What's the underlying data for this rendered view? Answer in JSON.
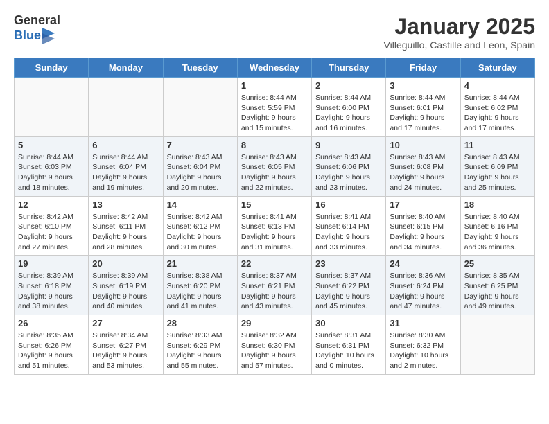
{
  "header": {
    "logo": {
      "general": "General",
      "blue": "Blue"
    },
    "title": "January 2025",
    "subtitle": "Villeguillo, Castille and Leon, Spain"
  },
  "weekdays": [
    "Sunday",
    "Monday",
    "Tuesday",
    "Wednesday",
    "Thursday",
    "Friday",
    "Saturday"
  ],
  "weeks": [
    [
      {
        "day": "",
        "sunrise": "",
        "sunset": "",
        "daylight": ""
      },
      {
        "day": "",
        "sunrise": "",
        "sunset": "",
        "daylight": ""
      },
      {
        "day": "",
        "sunrise": "",
        "sunset": "",
        "daylight": ""
      },
      {
        "day": "1",
        "sunrise": "Sunrise: 8:44 AM",
        "sunset": "Sunset: 5:59 PM",
        "daylight": "Daylight: 9 hours and 15 minutes."
      },
      {
        "day": "2",
        "sunrise": "Sunrise: 8:44 AM",
        "sunset": "Sunset: 6:00 PM",
        "daylight": "Daylight: 9 hours and 16 minutes."
      },
      {
        "day": "3",
        "sunrise": "Sunrise: 8:44 AM",
        "sunset": "Sunset: 6:01 PM",
        "daylight": "Daylight: 9 hours and 17 minutes."
      },
      {
        "day": "4",
        "sunrise": "Sunrise: 8:44 AM",
        "sunset": "Sunset: 6:02 PM",
        "daylight": "Daylight: 9 hours and 17 minutes."
      }
    ],
    [
      {
        "day": "5",
        "sunrise": "Sunrise: 8:44 AM",
        "sunset": "Sunset: 6:03 PM",
        "daylight": "Daylight: 9 hours and 18 minutes."
      },
      {
        "day": "6",
        "sunrise": "Sunrise: 8:44 AM",
        "sunset": "Sunset: 6:04 PM",
        "daylight": "Daylight: 9 hours and 19 minutes."
      },
      {
        "day": "7",
        "sunrise": "Sunrise: 8:43 AM",
        "sunset": "Sunset: 6:04 PM",
        "daylight": "Daylight: 9 hours and 20 minutes."
      },
      {
        "day": "8",
        "sunrise": "Sunrise: 8:43 AM",
        "sunset": "Sunset: 6:05 PM",
        "daylight": "Daylight: 9 hours and 22 minutes."
      },
      {
        "day": "9",
        "sunrise": "Sunrise: 8:43 AM",
        "sunset": "Sunset: 6:06 PM",
        "daylight": "Daylight: 9 hours and 23 minutes."
      },
      {
        "day": "10",
        "sunrise": "Sunrise: 8:43 AM",
        "sunset": "Sunset: 6:08 PM",
        "daylight": "Daylight: 9 hours and 24 minutes."
      },
      {
        "day": "11",
        "sunrise": "Sunrise: 8:43 AM",
        "sunset": "Sunset: 6:09 PM",
        "daylight": "Daylight: 9 hours and 25 minutes."
      }
    ],
    [
      {
        "day": "12",
        "sunrise": "Sunrise: 8:42 AM",
        "sunset": "Sunset: 6:10 PM",
        "daylight": "Daylight: 9 hours and 27 minutes."
      },
      {
        "day": "13",
        "sunrise": "Sunrise: 8:42 AM",
        "sunset": "Sunset: 6:11 PM",
        "daylight": "Daylight: 9 hours and 28 minutes."
      },
      {
        "day": "14",
        "sunrise": "Sunrise: 8:42 AM",
        "sunset": "Sunset: 6:12 PM",
        "daylight": "Daylight: 9 hours and 30 minutes."
      },
      {
        "day": "15",
        "sunrise": "Sunrise: 8:41 AM",
        "sunset": "Sunset: 6:13 PM",
        "daylight": "Daylight: 9 hours and 31 minutes."
      },
      {
        "day": "16",
        "sunrise": "Sunrise: 8:41 AM",
        "sunset": "Sunset: 6:14 PM",
        "daylight": "Daylight: 9 hours and 33 minutes."
      },
      {
        "day": "17",
        "sunrise": "Sunrise: 8:40 AM",
        "sunset": "Sunset: 6:15 PM",
        "daylight": "Daylight: 9 hours and 34 minutes."
      },
      {
        "day": "18",
        "sunrise": "Sunrise: 8:40 AM",
        "sunset": "Sunset: 6:16 PM",
        "daylight": "Daylight: 9 hours and 36 minutes."
      }
    ],
    [
      {
        "day": "19",
        "sunrise": "Sunrise: 8:39 AM",
        "sunset": "Sunset: 6:18 PM",
        "daylight": "Daylight: 9 hours and 38 minutes."
      },
      {
        "day": "20",
        "sunrise": "Sunrise: 8:39 AM",
        "sunset": "Sunset: 6:19 PM",
        "daylight": "Daylight: 9 hours and 40 minutes."
      },
      {
        "day": "21",
        "sunrise": "Sunrise: 8:38 AM",
        "sunset": "Sunset: 6:20 PM",
        "daylight": "Daylight: 9 hours and 41 minutes."
      },
      {
        "day": "22",
        "sunrise": "Sunrise: 8:37 AM",
        "sunset": "Sunset: 6:21 PM",
        "daylight": "Daylight: 9 hours and 43 minutes."
      },
      {
        "day": "23",
        "sunrise": "Sunrise: 8:37 AM",
        "sunset": "Sunset: 6:22 PM",
        "daylight": "Daylight: 9 hours and 45 minutes."
      },
      {
        "day": "24",
        "sunrise": "Sunrise: 8:36 AM",
        "sunset": "Sunset: 6:24 PM",
        "daylight": "Daylight: 9 hours and 47 minutes."
      },
      {
        "day": "25",
        "sunrise": "Sunrise: 8:35 AM",
        "sunset": "Sunset: 6:25 PM",
        "daylight": "Daylight: 9 hours and 49 minutes."
      }
    ],
    [
      {
        "day": "26",
        "sunrise": "Sunrise: 8:35 AM",
        "sunset": "Sunset: 6:26 PM",
        "daylight": "Daylight: 9 hours and 51 minutes."
      },
      {
        "day": "27",
        "sunrise": "Sunrise: 8:34 AM",
        "sunset": "Sunset: 6:27 PM",
        "daylight": "Daylight: 9 hours and 53 minutes."
      },
      {
        "day": "28",
        "sunrise": "Sunrise: 8:33 AM",
        "sunset": "Sunset: 6:29 PM",
        "daylight": "Daylight: 9 hours and 55 minutes."
      },
      {
        "day": "29",
        "sunrise": "Sunrise: 8:32 AM",
        "sunset": "Sunset: 6:30 PM",
        "daylight": "Daylight: 9 hours and 57 minutes."
      },
      {
        "day": "30",
        "sunrise": "Sunrise: 8:31 AM",
        "sunset": "Sunset: 6:31 PM",
        "daylight": "Daylight: 10 hours and 0 minutes."
      },
      {
        "day": "31",
        "sunrise": "Sunrise: 8:30 AM",
        "sunset": "Sunset: 6:32 PM",
        "daylight": "Daylight: 10 hours and 2 minutes."
      },
      {
        "day": "",
        "sunrise": "",
        "sunset": "",
        "daylight": ""
      }
    ]
  ]
}
